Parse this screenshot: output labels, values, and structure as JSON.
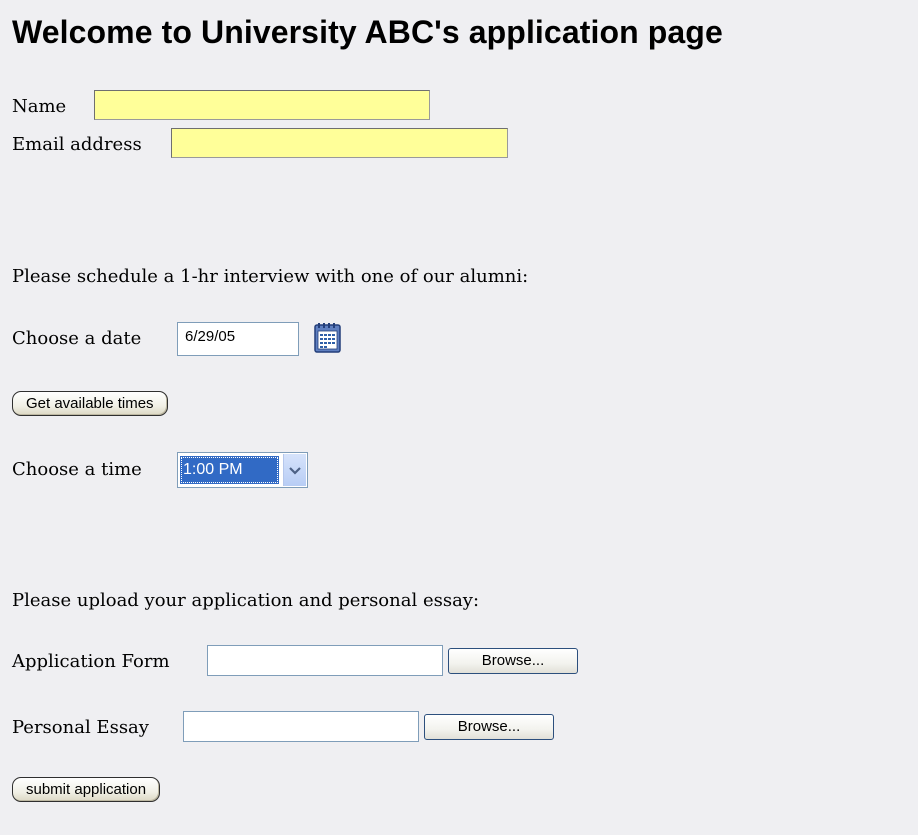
{
  "header": {
    "title": "Welcome to University ABC's application page"
  },
  "contact": {
    "name_label": "Name",
    "name_value": "",
    "email_label": "Email address",
    "email_value": ""
  },
  "interview": {
    "intro": "Please schedule a 1-hr interview with one of our alumni:",
    "date_label": "Choose a date",
    "date_value": "6/29/05",
    "calendar_icon": "calendar-icon",
    "get_times_label": "Get available times",
    "time_label": "Choose a time",
    "time_selected": "1:00 PM"
  },
  "upload": {
    "intro": "Please upload your application and personal essay:",
    "application_label": "Application Form",
    "application_value": "",
    "essay_label": "Personal Essay",
    "essay_value": "",
    "browse_label": "Browse..."
  },
  "submit": {
    "label": "submit application"
  },
  "colors": {
    "background": "#efeff2",
    "required_field": "#ffff99",
    "selection": "#316ac5"
  }
}
